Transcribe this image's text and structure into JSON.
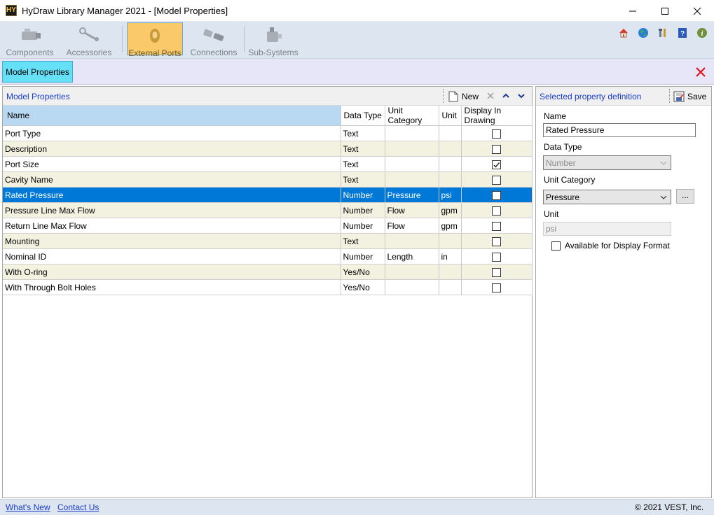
{
  "window": {
    "title": "HyDraw Library Manager 2021 - [Model Properties]",
    "app_icon_letters": "HY"
  },
  "ribbon": {
    "buttons": [
      {
        "label": "Components",
        "icon": "components-icon"
      },
      {
        "label": "Accessories",
        "icon": "accessories-icon"
      },
      {
        "label": "External Ports",
        "icon": "external-ports-icon",
        "active": true
      },
      {
        "label": "Connections",
        "icon": "connections-icon"
      },
      {
        "label": "Sub-Systems",
        "icon": "sub-systems-icon"
      }
    ],
    "right_icons": [
      "home-icon",
      "globe-icon",
      "tools-icon",
      "help-icon",
      "info-icon"
    ]
  },
  "tabs": {
    "active_label": "Model Properties"
  },
  "model_properties": {
    "title": "Model Properties",
    "new_label": "New",
    "columns": [
      "Name",
      "Data Type",
      "Unit Category",
      "Unit",
      "Display In Drawing"
    ],
    "rows": [
      {
        "name": "Port Type",
        "data_type": "Text",
        "unit_category": "",
        "unit": "",
        "display": false
      },
      {
        "name": "Description",
        "data_type": "Text",
        "unit_category": "",
        "unit": "",
        "display": false
      },
      {
        "name": "Port Size",
        "data_type": "Text",
        "unit_category": "",
        "unit": "",
        "display": true
      },
      {
        "name": "Cavity Name",
        "data_type": "Text",
        "unit_category": "",
        "unit": "",
        "display": false
      },
      {
        "name": "Rated Pressure",
        "data_type": "Number",
        "unit_category": "Pressure",
        "unit": "psi",
        "display": false,
        "selected": true
      },
      {
        "name": "Pressure Line Max Flow",
        "data_type": "Number",
        "unit_category": "Flow",
        "unit": "gpm",
        "display": false
      },
      {
        "name": "Return Line Max Flow",
        "data_type": "Number",
        "unit_category": "Flow",
        "unit": "gpm",
        "display": false
      },
      {
        "name": "Mounting",
        "data_type": "Text",
        "unit_category": "",
        "unit": "",
        "display": false
      },
      {
        "name": "Nominal ID",
        "data_type": "Number",
        "unit_category": "Length",
        "unit": "in",
        "display": false
      },
      {
        "name": "With O-ring",
        "data_type": "Yes/No",
        "unit_category": "",
        "unit": "",
        "display": false
      },
      {
        "name": "With Through Bolt Holes",
        "data_type": "Yes/No",
        "unit_category": "",
        "unit": "",
        "display": false
      }
    ]
  },
  "property_definition": {
    "title": "Selected property definition",
    "save_label": "Save",
    "name_label": "Name",
    "name_value": "Rated Pressure",
    "data_type_label": "Data Type",
    "data_type_value": "Number",
    "unit_category_label": "Unit Category",
    "unit_category_value": "Pressure",
    "ellipsis_label": "...",
    "unit_label": "Unit",
    "unit_value": "psi",
    "display_format_label": "Available for Display Format",
    "display_format_checked": false
  },
  "footer": {
    "whats_new": "What's New",
    "contact_us": "Contact Us",
    "copyright": "© 2021 VEST, Inc."
  },
  "colors": {
    "accent_selected_row": "#0078d7",
    "active_tab": "#66e0f6",
    "active_ribbon": "#f9c96a",
    "link": "#1a3cc8",
    "close_red": "#e0141e"
  }
}
